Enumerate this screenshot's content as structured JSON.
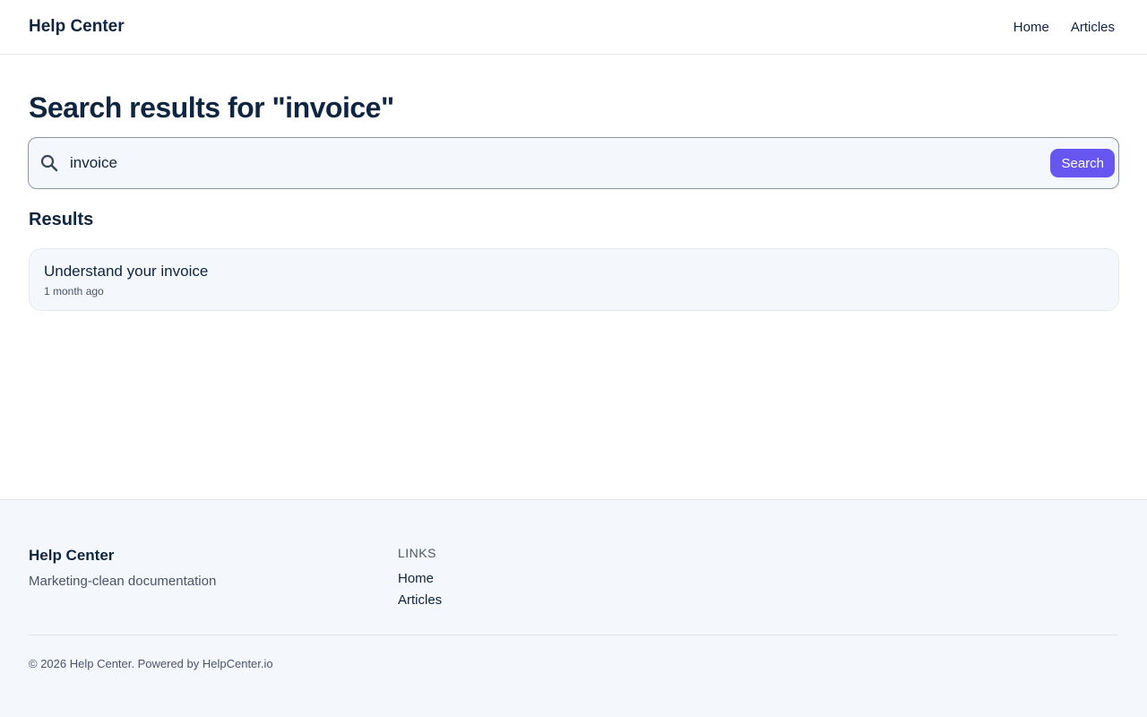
{
  "header": {
    "brand": "Help Center",
    "nav": [
      {
        "label": "Home"
      },
      {
        "label": "Articles"
      }
    ]
  },
  "main": {
    "title": "Search results for \"invoice\"",
    "search": {
      "value": "invoice",
      "button_label": "Search",
      "icon": "search-icon"
    },
    "results_heading": "Results",
    "results": [
      {
        "title": "Understand your invoice",
        "meta": "1 month ago"
      }
    ]
  },
  "footer": {
    "brand": "Help Center",
    "tagline": "Marketing-clean documentation",
    "links_heading": "LINKS",
    "links": [
      {
        "label": "Home"
      },
      {
        "label": "Articles"
      }
    ],
    "copyright": "© 2026 Help Center. Powered by HelpCenter.io"
  },
  "colors": {
    "accent": "#6757f0",
    "text": "#0f2540",
    "muted": "#4a5566",
    "surface": "#f4f7fb"
  }
}
